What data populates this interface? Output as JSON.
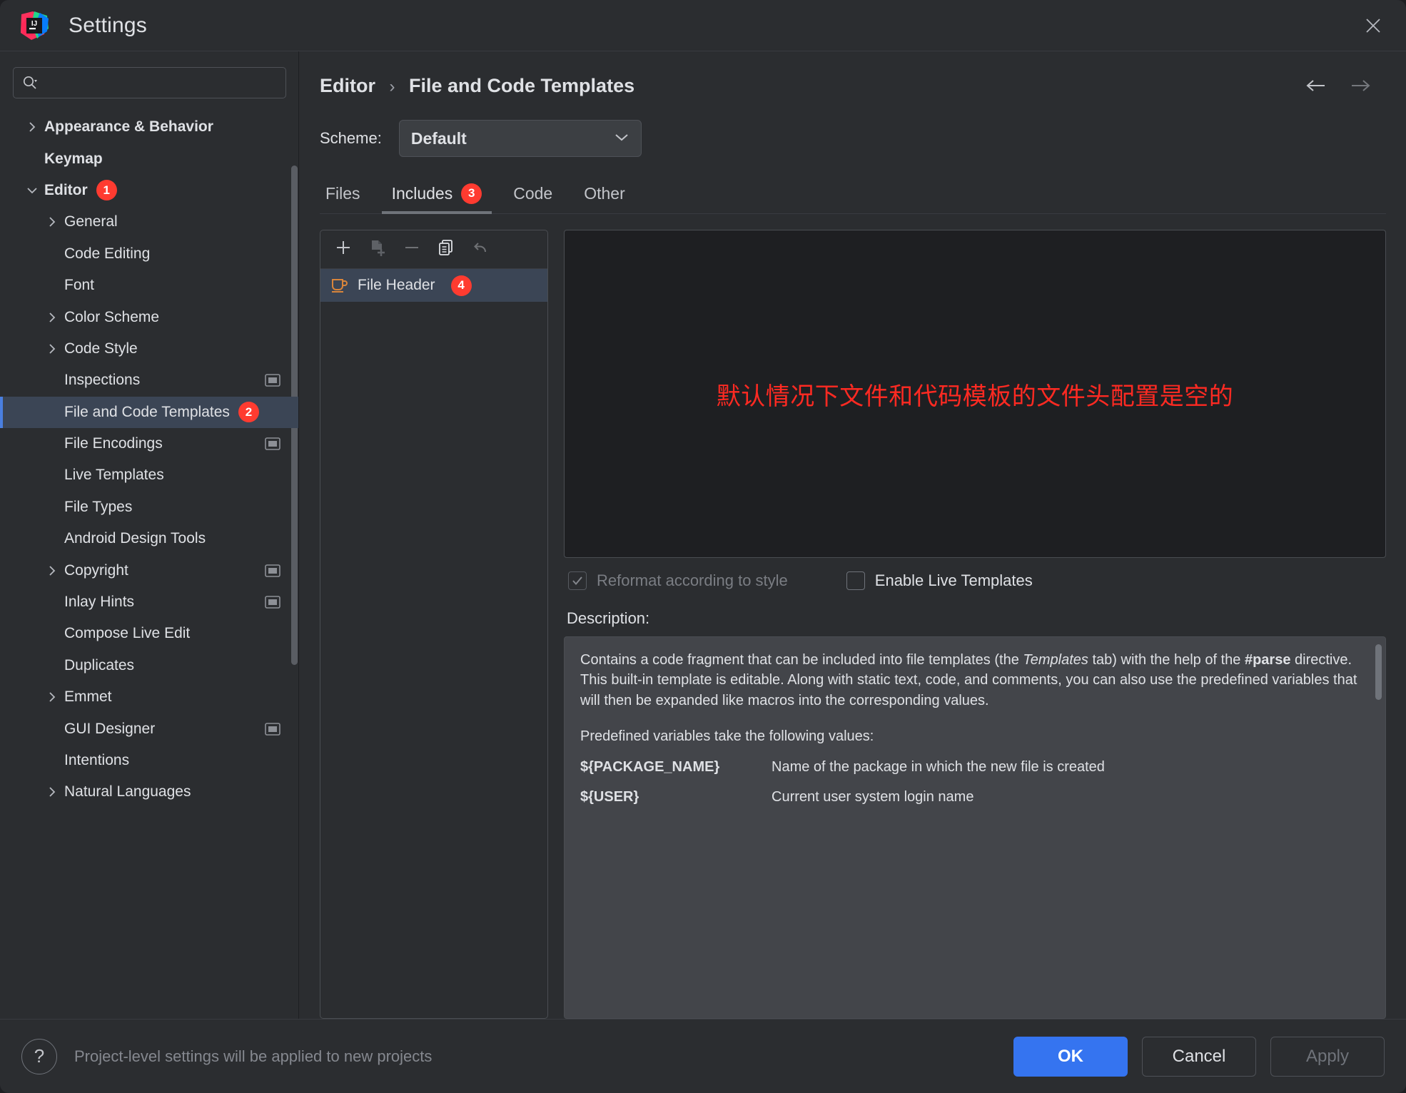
{
  "window": {
    "title": "Settings",
    "logo_icon": "intellij-idea-logo",
    "close_icon": "close-icon"
  },
  "search": {
    "placeholder": "",
    "value": "",
    "icon": "search-icon"
  },
  "sidebar": {
    "items": [
      {
        "label": "Appearance & Behavior",
        "level": 0,
        "twisty": "chevron-right",
        "bold": true,
        "badge": "",
        "project_icon": false,
        "selected": false
      },
      {
        "label": "Keymap",
        "level": 0,
        "twisty": "",
        "bold": true,
        "badge": "",
        "project_icon": false,
        "selected": false
      },
      {
        "label": "Editor",
        "level": 0,
        "twisty": "chevron-down",
        "bold": true,
        "badge": "1",
        "project_icon": false,
        "selected": false
      },
      {
        "label": "General",
        "level": 1,
        "twisty": "chevron-right",
        "bold": false,
        "badge": "",
        "project_icon": false,
        "selected": false
      },
      {
        "label": "Code Editing",
        "level": 1,
        "twisty": "",
        "bold": false,
        "badge": "",
        "project_icon": false,
        "selected": false
      },
      {
        "label": "Font",
        "level": 1,
        "twisty": "",
        "bold": false,
        "badge": "",
        "project_icon": false,
        "selected": false
      },
      {
        "label": "Color Scheme",
        "level": 1,
        "twisty": "chevron-right",
        "bold": false,
        "badge": "",
        "project_icon": false,
        "selected": false
      },
      {
        "label": "Code Style",
        "level": 1,
        "twisty": "chevron-right",
        "bold": false,
        "badge": "",
        "project_icon": false,
        "selected": false
      },
      {
        "label": "Inspections",
        "level": 1,
        "twisty": "",
        "bold": false,
        "badge": "",
        "project_icon": true,
        "selected": false
      },
      {
        "label": "File and Code Templates",
        "level": 1,
        "twisty": "",
        "bold": false,
        "badge": "2",
        "project_icon": false,
        "selected": true
      },
      {
        "label": "File Encodings",
        "level": 1,
        "twisty": "",
        "bold": false,
        "badge": "",
        "project_icon": true,
        "selected": false
      },
      {
        "label": "Live Templates",
        "level": 1,
        "twisty": "",
        "bold": false,
        "badge": "",
        "project_icon": false,
        "selected": false
      },
      {
        "label": "File Types",
        "level": 1,
        "twisty": "",
        "bold": false,
        "badge": "",
        "project_icon": false,
        "selected": false
      },
      {
        "label": "Android Design Tools",
        "level": 1,
        "twisty": "",
        "bold": false,
        "badge": "",
        "project_icon": false,
        "selected": false
      },
      {
        "label": "Copyright",
        "level": 1,
        "twisty": "chevron-right",
        "bold": false,
        "badge": "",
        "project_icon": true,
        "selected": false
      },
      {
        "label": "Inlay Hints",
        "level": 1,
        "twisty": "",
        "bold": false,
        "badge": "",
        "project_icon": true,
        "selected": false
      },
      {
        "label": "Compose Live Edit",
        "level": 1,
        "twisty": "",
        "bold": false,
        "badge": "",
        "project_icon": false,
        "selected": false
      },
      {
        "label": "Duplicates",
        "level": 1,
        "twisty": "",
        "bold": false,
        "badge": "",
        "project_icon": false,
        "selected": false
      },
      {
        "label": "Emmet",
        "level": 1,
        "twisty": "chevron-right",
        "bold": false,
        "badge": "",
        "project_icon": false,
        "selected": false
      },
      {
        "label": "GUI Designer",
        "level": 1,
        "twisty": "",
        "bold": false,
        "badge": "",
        "project_icon": true,
        "selected": false
      },
      {
        "label": "Intentions",
        "level": 1,
        "twisty": "",
        "bold": false,
        "badge": "",
        "project_icon": false,
        "selected": false
      },
      {
        "label": "Natural Languages",
        "level": 1,
        "twisty": "chevron-right",
        "bold": false,
        "badge": "",
        "project_icon": false,
        "selected": false
      }
    ]
  },
  "main": {
    "breadcrumb": {
      "parent": "Editor",
      "separator": "›",
      "current": "File and Code Templates"
    },
    "nav": {
      "back_icon": "arrow-left-icon",
      "forward_icon": "arrow-right-icon"
    },
    "scheme": {
      "label": "Scheme:",
      "value": "Default",
      "chevron_icon": "chevron-down-icon"
    },
    "tabs": [
      {
        "label": "Files",
        "badge": "",
        "active": false
      },
      {
        "label": "Includes",
        "badge": "3",
        "active": true
      },
      {
        "label": "Code",
        "badge": "",
        "active": false
      },
      {
        "label": "Other",
        "badge": "",
        "active": false
      }
    ],
    "toolbar": [
      {
        "name": "add-button",
        "icon": "plus-icon",
        "disabled": false
      },
      {
        "name": "create-from-file-button",
        "icon": "add-file-icon",
        "disabled": true
      },
      {
        "name": "remove-button",
        "icon": "minus-icon",
        "disabled": true
      },
      {
        "name": "copy-button",
        "icon": "copy-icon",
        "disabled": false
      },
      {
        "name": "reset-button",
        "icon": "undo-icon",
        "disabled": true
      }
    ],
    "templates": [
      {
        "label": "File Header",
        "icon": "java-coffee-cup-icon",
        "badge": "4",
        "selected": true
      }
    ],
    "editor": {
      "content": "",
      "annotation": "默认情况下文件和代码模板的文件头配置是空的",
      "annotation_color": "#ff2a22"
    },
    "options": [
      {
        "label": "Reformat according to style",
        "checked": true,
        "disabled": true
      },
      {
        "label": "Enable Live Templates",
        "checked": false,
        "disabled": false
      }
    ],
    "description": {
      "label": "Description:",
      "para1_a": "Contains a code fragment that can be included into file templates (the ",
      "para1_italic": "Templates",
      "para1_b": " tab) with the help of the ",
      "para1_bold": "#parse",
      "para1_c": " directive.",
      "para2": "This built-in template is editable. Along with static text, code, and comments, you can also use the predefined variables that will then be expanded like macros into the corresponding values.",
      "para3": "Predefined variables take the following values:",
      "variables": [
        {
          "name": "${PACKAGE_NAME}",
          "desc": "Name of the package in which the new file is created"
        },
        {
          "name": "${USER}",
          "desc": "Current user system login name"
        }
      ]
    }
  },
  "footer": {
    "help_icon": "question-mark-icon",
    "note": "Project-level settings will be applied to new projects",
    "buttons": [
      {
        "label": "OK",
        "style": "primary",
        "disabled": false
      },
      {
        "label": "Cancel",
        "style": "default",
        "disabled": false
      },
      {
        "label": "Apply",
        "style": "default",
        "disabled": true
      }
    ]
  },
  "colors": {
    "accent": "#3574f0",
    "badge": "#ff3b30",
    "selection": "#3b4555",
    "annotation": "#ff2a22",
    "background": "#2b2d30"
  }
}
